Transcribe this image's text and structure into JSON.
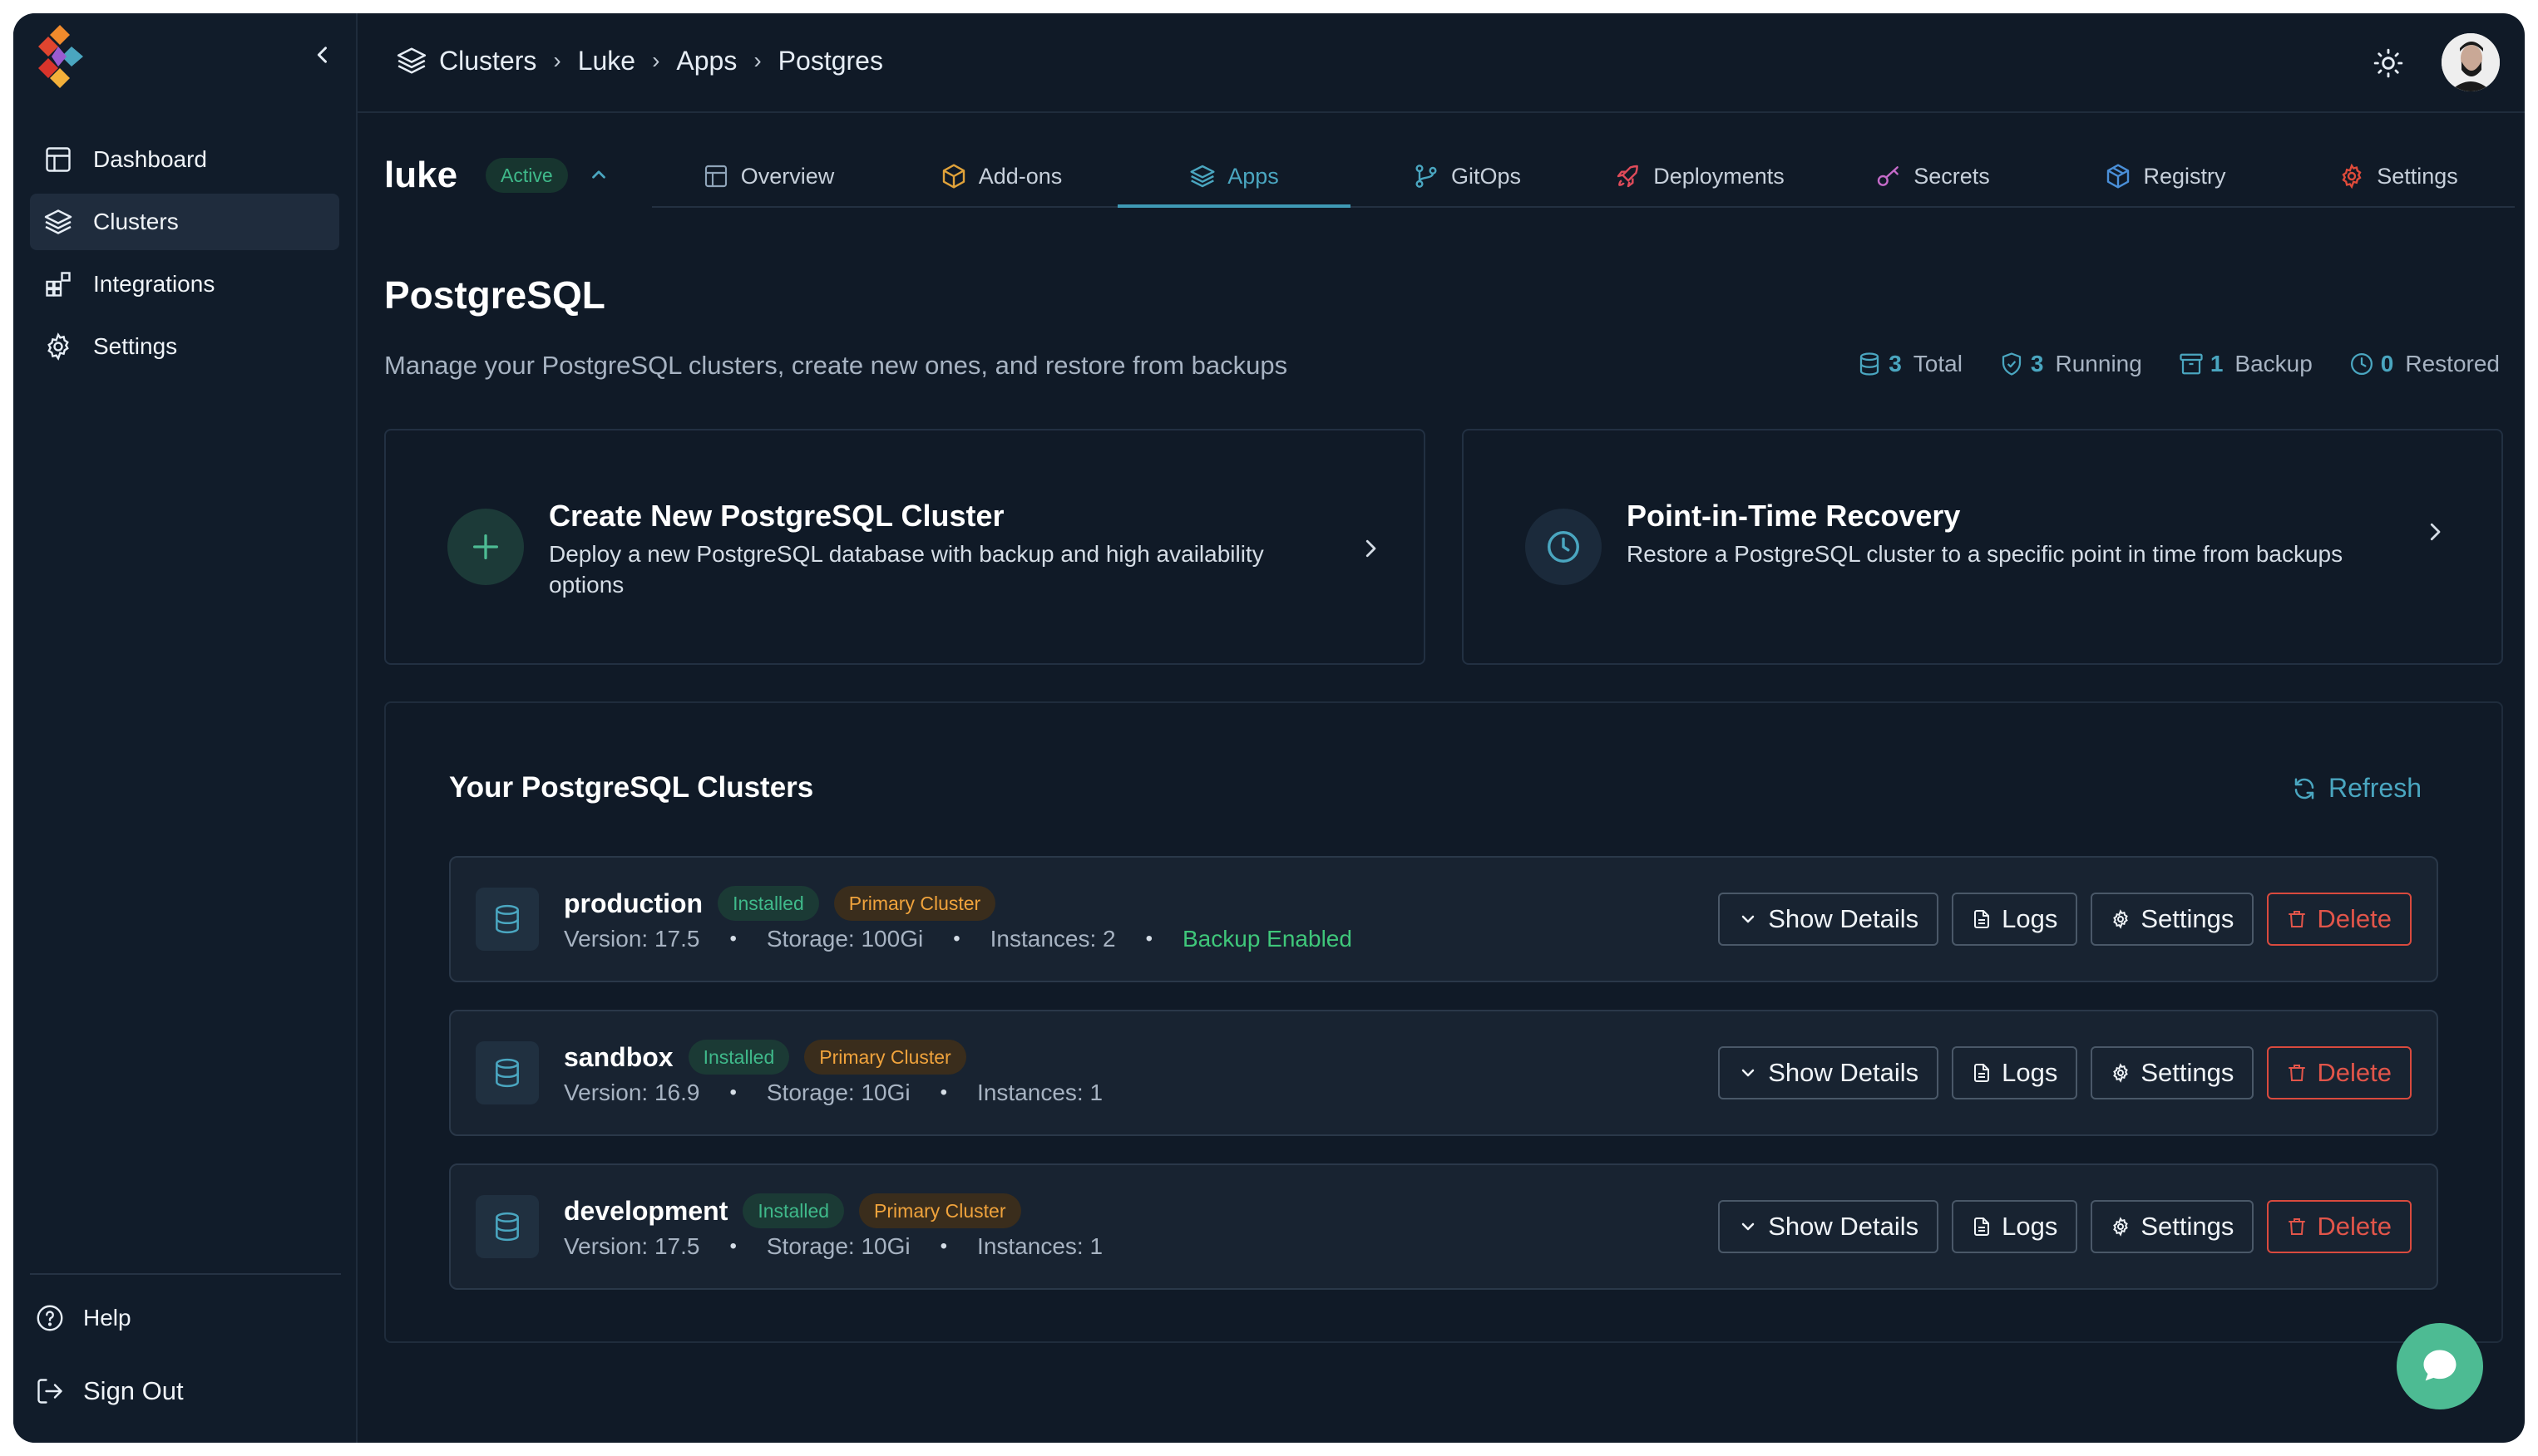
{
  "sidebar": {
    "items": [
      {
        "label": "Dashboard",
        "icon": "dashboard-icon"
      },
      {
        "label": "Clusters",
        "icon": "layers-icon",
        "active": true
      },
      {
        "label": "Integrations",
        "icon": "integrations-icon"
      },
      {
        "label": "Settings",
        "icon": "gear-icon"
      }
    ],
    "help_label": "Help",
    "signout_label": "Sign Out"
  },
  "breadcrumb": [
    "Clusters",
    "Luke",
    "Apps",
    "Postgres"
  ],
  "cluster": {
    "name": "luke",
    "status": "Active"
  },
  "tabs": [
    {
      "label": "Overview",
      "icon": "overview-icon"
    },
    {
      "label": "Add-ons",
      "icon": "box-icon"
    },
    {
      "label": "Apps",
      "icon": "layers-icon",
      "active": true
    },
    {
      "label": "GitOps",
      "icon": "git-branch-icon"
    },
    {
      "label": "Deployments",
      "icon": "rocket-icon"
    },
    {
      "label": "Secrets",
      "icon": "key-icon"
    },
    {
      "label": "Registry",
      "icon": "package-icon"
    },
    {
      "label": "Settings",
      "icon": "gear-icon"
    }
  ],
  "page": {
    "title": "PostgreSQL",
    "subtitle": "Manage your PostgreSQL clusters, create new ones, and restore from backups"
  },
  "stats": [
    {
      "value": "3",
      "label": "Total",
      "icon": "database-icon"
    },
    {
      "value": "3",
      "label": "Running",
      "icon": "shield-check-icon"
    },
    {
      "value": "1",
      "label": "Backup",
      "icon": "archive-icon"
    },
    {
      "value": "0",
      "label": "Restored",
      "icon": "clock-icon"
    }
  ],
  "cards": {
    "create": {
      "title": "Create New PostgreSQL Cluster",
      "desc_line1": "Deploy a new PostgreSQL database with backup and high availability",
      "desc_line2": "options"
    },
    "recovery": {
      "title": "Point-in-Time Recovery",
      "desc": "Restore a PostgreSQL cluster to a specific point in time from backups"
    }
  },
  "clusters_panel": {
    "title": "Your PostgreSQL Clusters",
    "refresh_label": "Refresh"
  },
  "clusters": [
    {
      "name": "production",
      "installed": "Installed",
      "role": "Primary Cluster",
      "version": "Version: 17.5",
      "storage": "Storage: 100Gi",
      "instances": "Instances: 2",
      "backup": "Backup Enabled"
    },
    {
      "name": "sandbox",
      "installed": "Installed",
      "role": "Primary Cluster",
      "version": "Version: 16.9",
      "storage": "Storage: 10Gi",
      "instances": "Instances: 1"
    },
    {
      "name": "development",
      "installed": "Installed",
      "role": "Primary Cluster",
      "version": "Version: 17.5",
      "storage": "Storage: 10Gi",
      "instances": "Instances: 1"
    }
  ],
  "row_actions": {
    "details": "Show Details",
    "logs": "Logs",
    "settings": "Settings",
    "delete": "Delete"
  },
  "colors": {
    "background": "#101a27",
    "accent": "#4aa6c0",
    "success": "#3fb98a",
    "warning": "#f0a33c",
    "danger": "#e2554a",
    "chat": "#4dbb93"
  }
}
